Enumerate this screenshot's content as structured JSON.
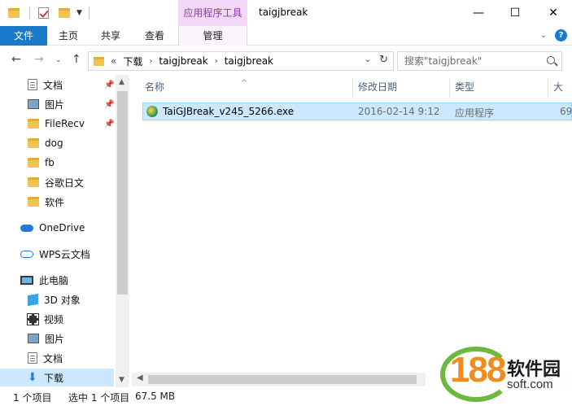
{
  "titlebar": {
    "context_tab_group": "应用程序工具",
    "window_title": "taigjbreak",
    "minimize": "—",
    "maximize": "☐",
    "close": "✕"
  },
  "ribbon": {
    "tabs": [
      {
        "label": "文件"
      },
      {
        "label": "主页"
      },
      {
        "label": "共享"
      },
      {
        "label": "查看"
      },
      {
        "label": "管理"
      }
    ],
    "help": "?"
  },
  "address": {
    "prefix": "«",
    "crumbs": [
      "下载",
      "taigjbreak",
      "taigjbreak"
    ],
    "search_placeholder": "搜索\"taigjbreak\""
  },
  "navpane": {
    "items": [
      {
        "label": "文档",
        "icon": "document-icon",
        "pinned": true
      },
      {
        "label": "图片",
        "icon": "picture-icon",
        "pinned": true
      },
      {
        "label": "FileRecv",
        "icon": "folder-icon",
        "pinned": true
      },
      {
        "label": "dog",
        "icon": "folder-icon"
      },
      {
        "label": "fb",
        "icon": "folder-icon"
      },
      {
        "label": "谷歌日文",
        "icon": "folder-icon"
      },
      {
        "label": "软件",
        "icon": "folder-icon"
      },
      {
        "label": "OneDrive",
        "icon": "cloud-icon"
      },
      {
        "label": "WPS云文档",
        "icon": "cloud-outline-icon"
      },
      {
        "label": "此电脑",
        "icon": "computer-icon"
      },
      {
        "label": "3D 对象",
        "icon": "cube-icon"
      },
      {
        "label": "视频",
        "icon": "video-icon"
      },
      {
        "label": "图片",
        "icon": "picture-icon"
      },
      {
        "label": "文档",
        "icon": "document-icon"
      },
      {
        "label": "下载",
        "icon": "download-icon",
        "selected": true
      }
    ]
  },
  "columns": [
    "名称",
    "修改日期",
    "类型",
    "大小"
  ],
  "files": [
    {
      "name": "TaiGJBreak_v245_5266.exe",
      "modified": "2016-02-14 9:12",
      "type": "应用程序",
      "size": "69"
    }
  ],
  "status": {
    "item_count": "1 个项目",
    "selected": "选中 1 个项目",
    "size": "67.5 MB"
  },
  "watermark": {
    "number": "188",
    "name_cn": "软件园",
    "domain": "soft.com"
  }
}
